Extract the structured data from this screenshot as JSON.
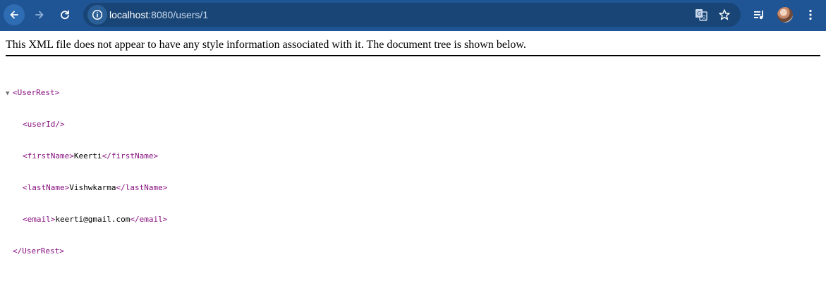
{
  "browser": {
    "url_host": "localhost",
    "url_path": ":8080/users/1",
    "icons": {
      "back": "arrow-left-icon",
      "forward": "arrow-right-icon",
      "reload": "reload-icon",
      "site_info": "info-icon",
      "translate": "translate-icon",
      "bookmark": "star-icon",
      "media": "media-queue-icon",
      "profile": "avatar",
      "menu": "kebab-menu-icon"
    },
    "colors": {
      "toolbar": "#1f5495",
      "omnibox": "#184575"
    }
  },
  "page": {
    "banner": "This XML file does not appear to have any style information associated with it. The document tree is shown below.",
    "xml": {
      "collapse_glyph": "▼",
      "root_open": "<UserRest>",
      "root_close": "</UserRest>",
      "children": [
        {
          "open": "<userId/>",
          "value": "",
          "close": ""
        },
        {
          "open": "<firstName>",
          "value": "Keerti",
          "close": "</firstName>"
        },
        {
          "open": "<lastName>",
          "value": "Vishwkarma",
          "close": "</lastName>"
        },
        {
          "open": "<email>",
          "value": "keerti@gmail.com",
          "close": "</email>"
        }
      ]
    },
    "colors": {
      "tag": "#881280",
      "text": "#000000"
    }
  }
}
